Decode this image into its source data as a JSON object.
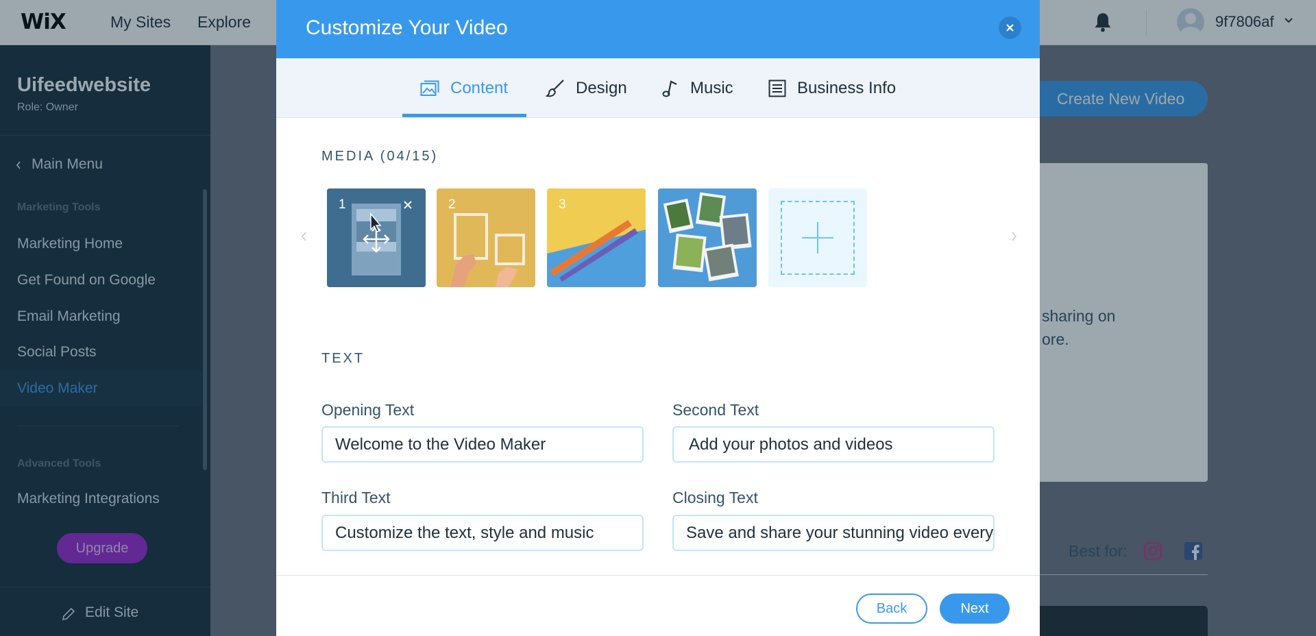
{
  "topbar": {
    "logo": "WiX",
    "nav": [
      "My Sites",
      "Explore"
    ],
    "username": "9f7806af"
  },
  "sidebar": {
    "site_name": "Uifeedwebsite",
    "role": "Role: Owner",
    "main_menu": "Main Menu",
    "section_marketing": "Marketing Tools",
    "items": [
      "Marketing Home",
      "Get Found on Google",
      "Email Marketing",
      "Social Posts",
      "Video Maker"
    ],
    "active_item": "Video Maker",
    "section_advanced": "Advanced Tools",
    "advanced_items": [
      "Marketing Integrations"
    ],
    "upgrade": "Upgrade",
    "edit_site": "Edit Site"
  },
  "background": {
    "create_button": "Create New Video",
    "desc_line1": "sharing on",
    "desc_line2": "ore.",
    "best_for": "Best for:"
  },
  "modal": {
    "title": "Customize Your Video",
    "tabs": [
      {
        "label": "Content",
        "icon": "image-icon"
      },
      {
        "label": "Design",
        "icon": "brush-icon"
      },
      {
        "label": "Music",
        "icon": "music-note-icon"
      },
      {
        "label": "Business Info",
        "icon": "list-icon"
      }
    ],
    "active_tab": "Content",
    "media_label": "MEDIA (04/15)",
    "media": [
      {
        "number": "1"
      },
      {
        "number": "2"
      },
      {
        "number": "3"
      },
      {
        "number": ""
      }
    ],
    "text_label": "TEXT",
    "fields": {
      "opening": {
        "label": "Opening Text",
        "value": "Welcome to the Video Maker"
      },
      "second": {
        "label": "Second Text",
        "value": "Add your photos and videos"
      },
      "third": {
        "label": "Third Text",
        "value": "Customize the text, style and music"
      },
      "closing": {
        "label": "Closing Text",
        "value": "Save and share your stunning video every"
      }
    },
    "back": "Back",
    "next": "Next"
  },
  "colors": {
    "accent": "#3899ec",
    "sidebar_bg": "#162d3d",
    "upgrade": "#9a27d5"
  }
}
